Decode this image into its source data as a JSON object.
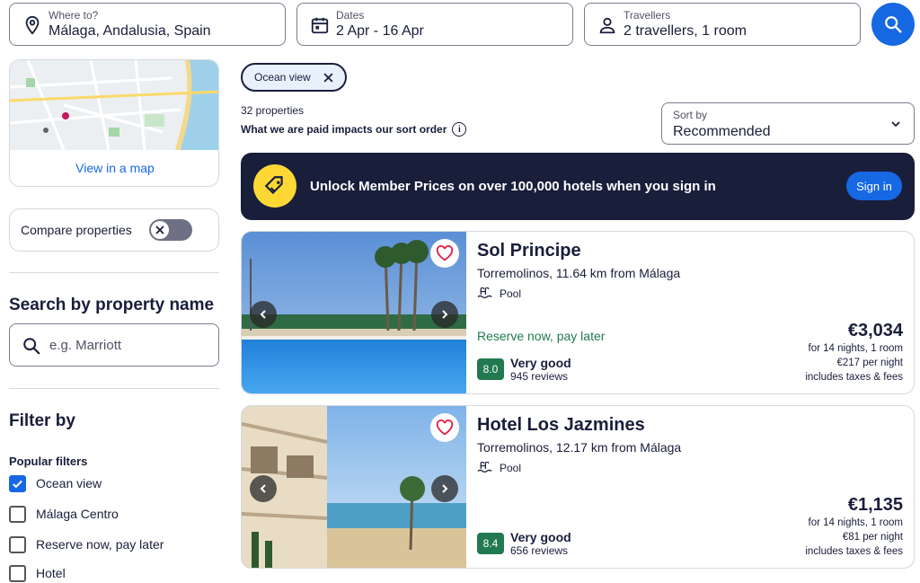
{
  "search": {
    "where": {
      "label": "Where to?",
      "value": "Málaga, Andalusia, Spain",
      "icon": "location-pin-icon"
    },
    "dates": {
      "label": "Dates",
      "value": "2 Apr - 16 Apr",
      "icon": "calendar-icon"
    },
    "travellers": {
      "label": "Travellers",
      "value": "2 travellers, 1 room",
      "icon": "person-icon"
    },
    "button_icon": "search-icon"
  },
  "sidebar": {
    "map_link": "View in a map",
    "compare_label": "Compare properties",
    "search_by_name": {
      "title": "Search by property name",
      "placeholder": "e.g. Marriott"
    },
    "filter_title": "Filter by",
    "popular_filters": {
      "title": "Popular filters",
      "items": [
        {
          "label": "Ocean view",
          "checked": true
        },
        {
          "label": "Málaga Centro",
          "checked": false
        },
        {
          "label": "Reserve now, pay later",
          "checked": false
        },
        {
          "label": "Hotel",
          "checked": false
        }
      ]
    }
  },
  "results": {
    "active_filter": "Ocean view",
    "count": "32 properties",
    "paid_note": "What we are paid impacts our sort order",
    "sort": {
      "label": "Sort by",
      "value": "Recommended"
    },
    "banner": {
      "text": "Unlock Member Prices on over 100,000 hotels when you sign in",
      "button": "Sign in"
    },
    "hotels": [
      {
        "name": "Sol Principe",
        "location": "Torremolinos, 11.64 km from Málaga",
        "amenity": "Pool",
        "reserve": "Reserve now, pay later",
        "score": "8.0",
        "rating": "Very good",
        "reviews": "945 reviews",
        "price": "€3,034",
        "nights": "for 14 nights, 1 room",
        "per_night": "€217 per night",
        "taxes": "includes taxes & fees"
      },
      {
        "name": "Hotel Los Jazmines",
        "location": "Torremolinos, 12.17 km from Málaga",
        "amenity": "Pool",
        "reserve": "",
        "score": "8.4",
        "rating": "Very good",
        "reviews": "656 reviews",
        "price": "€1,135",
        "nights": "for 14 nights, 1 room",
        "per_night": "€81 per night",
        "taxes": "includes taxes & fees"
      }
    ]
  },
  "colors": {
    "brand_blue": "#1668e3",
    "navy": "#191e3b",
    "green": "#227950",
    "heart_red": "#e31c3d"
  }
}
